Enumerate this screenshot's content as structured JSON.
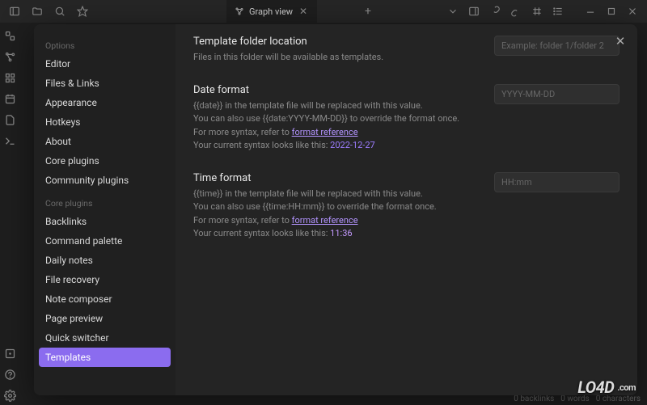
{
  "tab": {
    "title": "Graph view"
  },
  "statusbar": {
    "backlinks": "0 backlinks",
    "words": "0 words",
    "chars": "0 characters"
  },
  "sidebar": {
    "groups": [
      {
        "header": "Options",
        "items": [
          {
            "label": "Editor"
          },
          {
            "label": "Files & Links"
          },
          {
            "label": "Appearance"
          },
          {
            "label": "Hotkeys"
          },
          {
            "label": "About"
          },
          {
            "label": "Core plugins"
          },
          {
            "label": "Community plugins"
          }
        ]
      },
      {
        "header": "Core plugins",
        "items": [
          {
            "label": "Backlinks"
          },
          {
            "label": "Command palette"
          },
          {
            "label": "Daily notes"
          },
          {
            "label": "File recovery"
          },
          {
            "label": "Note composer"
          },
          {
            "label": "Page preview"
          },
          {
            "label": "Quick switcher"
          },
          {
            "label": "Templates",
            "active": true
          }
        ]
      }
    ]
  },
  "settings": {
    "folder": {
      "title": "Template folder location",
      "desc": "Files in this folder will be available as templates.",
      "placeholder": "Example: folder 1/folder 2"
    },
    "date": {
      "title": "Date format",
      "line1a": "{{date}} in the template file will be replaced with this value.",
      "line2": "You can also use {{date:YYYY-MM-DD}} to override the format once.",
      "line3a": "For more syntax, refer to ",
      "link": "format reference",
      "line4a": "Your current syntax looks like this: ",
      "preview": "2022-12-27",
      "placeholder": "YYYY-MM-DD"
    },
    "time": {
      "title": "Time format",
      "line1a": "{{time}} in the template file will be replaced with this value.",
      "line2": "You can also use {{time:HH:mm}} to override the format once.",
      "line3a": "For more syntax, refer to ",
      "link": "format reference",
      "line4a": "Your current syntax looks like this: ",
      "preview": "11:36",
      "placeholder": "HH:mm"
    }
  },
  "watermark": {
    "text": "LO4D",
    "suffix": ".com"
  }
}
